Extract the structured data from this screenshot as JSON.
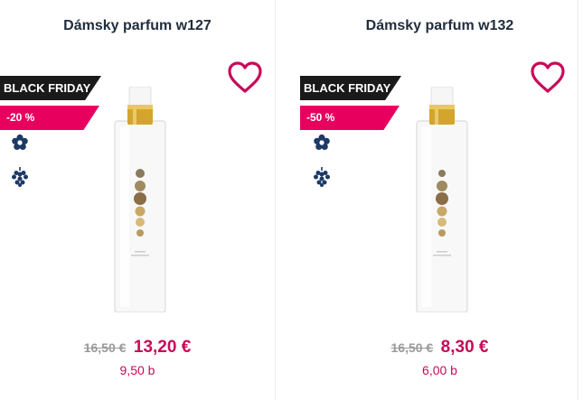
{
  "products": [
    {
      "title": "Dámsky parfum w127",
      "badge": "BLACK FRIDAY",
      "discount": "-20 %",
      "old_price": "16,50 €",
      "new_price": "13,20 €",
      "points": "9,50 b"
    },
    {
      "title": "Dámsky parfum w132",
      "badge": "BLACK FRIDAY",
      "discount": "-50 %",
      "old_price": "16,50 €",
      "new_price": "8,30 €",
      "points": "6,00 b"
    }
  ],
  "icons": {
    "wishlist": "heart-icon",
    "fragrance_family_floral": "flower-icon",
    "fragrance_family_fruity": "grapes-icon"
  },
  "colors": {
    "accent_pink": "#e8005f",
    "price_pink": "#c80a5a",
    "badge_dark": "#1a1a1a",
    "title_navy": "#1f2d3d",
    "icon_navy": "#1d3a66",
    "cap_gold": "#d4a52c"
  }
}
